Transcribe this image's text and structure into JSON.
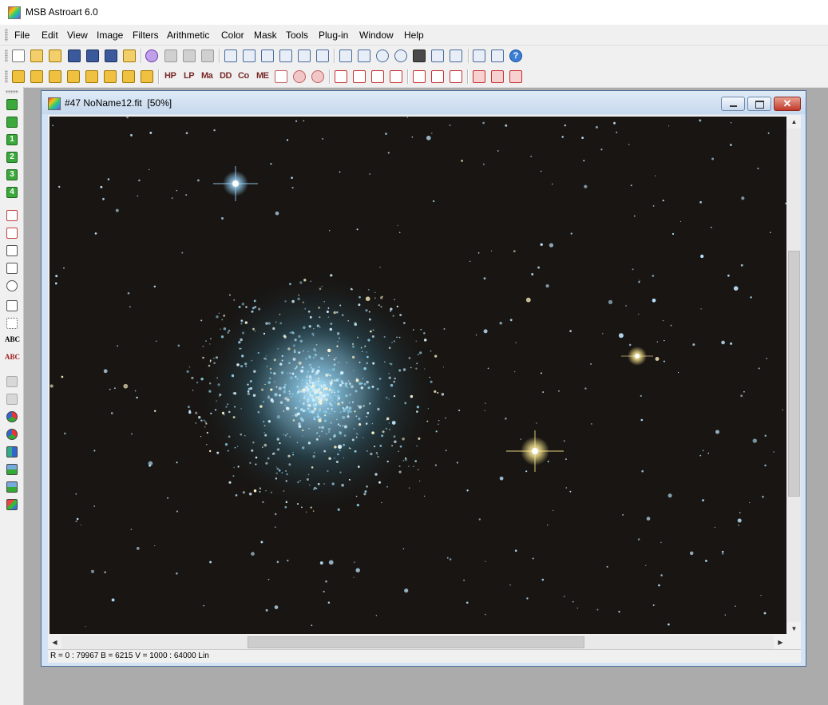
{
  "app": {
    "title": "MSB Astroart 6.0",
    "icon": "astroart-logo-icon"
  },
  "menu": [
    "File",
    "Edit",
    "View",
    "Image",
    "Filters",
    "Arithmetic",
    "Color",
    "Mask",
    "Tools",
    "Plug-in",
    "Window",
    "Help"
  ],
  "toolbar2_text_buttons": [
    "HP",
    "LP",
    "Ma",
    "DD",
    "Co",
    "ME"
  ],
  "toolbar1_icons": [
    "new-icon",
    "open-icon",
    "open-folder-icon",
    "save-icon",
    "save-as-icon",
    "save-all-icon",
    "browse-icon",
    "refresh-icon",
    "copy-image-icon",
    "copy-icon",
    "paste-icon",
    "info-icon",
    "histogram-icon",
    "level-icon",
    "circle-icon",
    "photometry-icon",
    "sum-icon",
    "small-window-icon",
    "large-window-icon",
    "zoom-in-icon",
    "zoom-out-icon",
    "monitor-icon",
    "fit-window-icon",
    "fit-screen-icon",
    "align-icon",
    "stack-icon",
    "help-icon"
  ],
  "lefttoolbar_labels": {
    "green": [
      "1",
      "2",
      "3",
      "4"
    ],
    "abc": "ABC",
    "abc2": "ABC"
  },
  "document": {
    "title": "#47 NoName12.fit  [50%]",
    "status": "R = 0 : 79967    B = 6215    V = 1000 : 64000 Lin"
  },
  "colors": {
    "sky": "#181512",
    "star_blue": "#bfe6ff",
    "star_yellow": "#ffefa0",
    "titlebar_bg": "#c6d9ee"
  }
}
